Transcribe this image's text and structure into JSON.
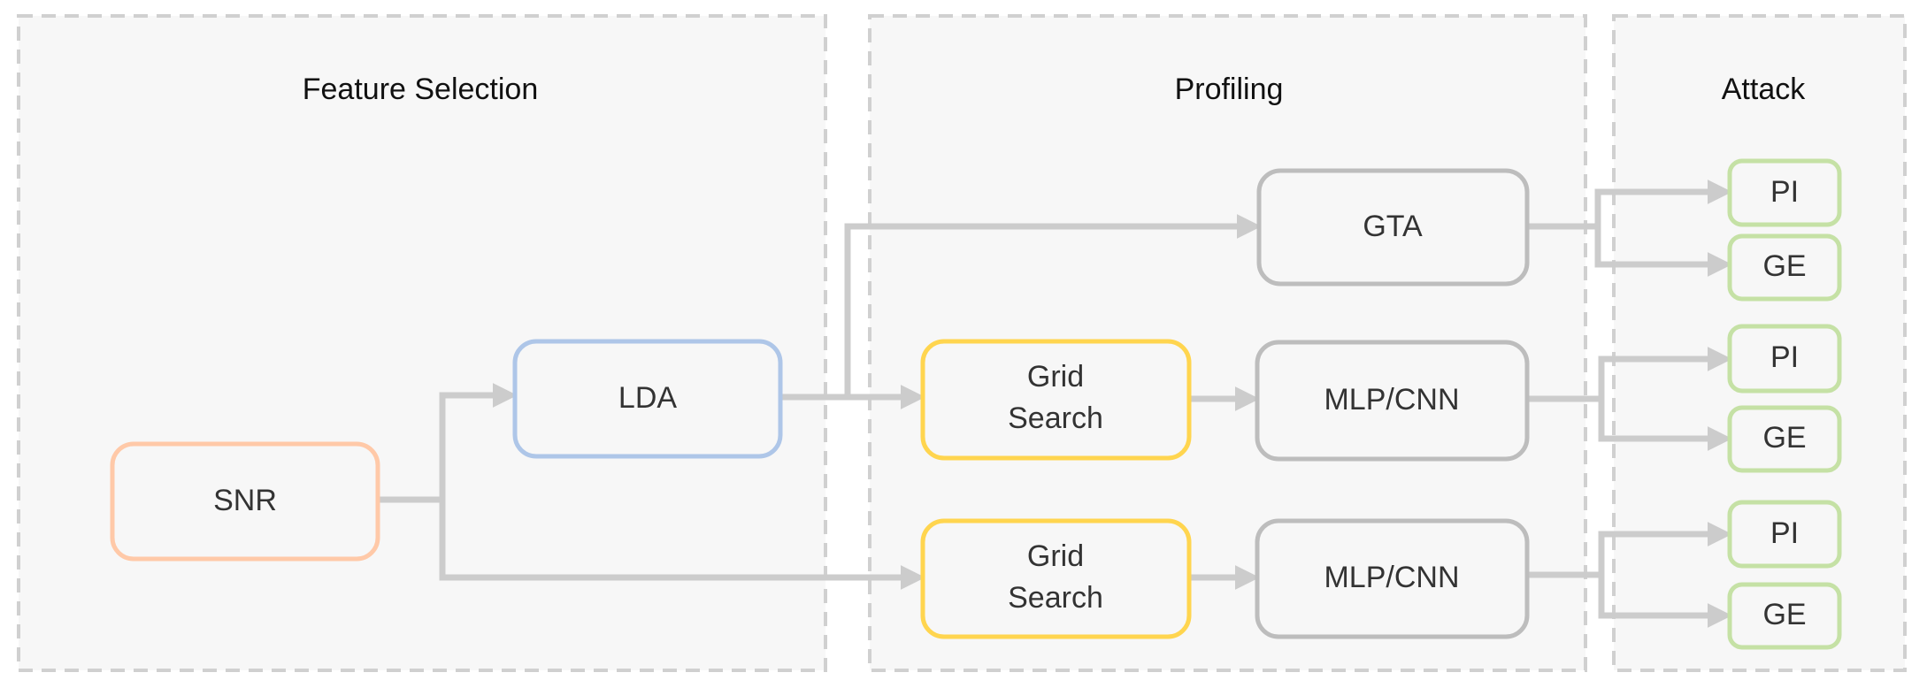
{
  "sections": [
    {
      "title": "Feature Selection"
    },
    {
      "title": "Profiling"
    },
    {
      "title": "Attack"
    }
  ],
  "nodes": {
    "snr": {
      "label": "SNR",
      "color": "#ffc9a8"
    },
    "lda": {
      "label": "LDA",
      "color": "#aec6e8"
    },
    "gta": {
      "label": "GTA",
      "color": "#bdbdbd"
    },
    "grid1": {
      "label_line1": "Grid",
      "label_line2": "Search",
      "color": "#ffd54f"
    },
    "mlp1": {
      "label": "MLP/CNN",
      "color": "#bdbdbd"
    },
    "grid2": {
      "label_line1": "Grid",
      "label_line2": "Search",
      "color": "#ffd54f"
    },
    "mlp2": {
      "label": "MLP/CNN",
      "color": "#bdbdbd"
    },
    "attack": [
      {
        "pi": "PI",
        "ge": "GE"
      },
      {
        "pi": "PI",
        "ge": "GE"
      },
      {
        "pi": "PI",
        "ge": "GE"
      }
    ],
    "attack_color": "#c5e1a5"
  },
  "edge_color": "#cccccc"
}
